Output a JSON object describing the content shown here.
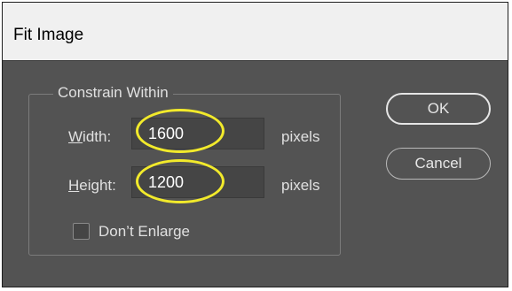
{
  "dialog": {
    "title": "Fit Image",
    "constrain": {
      "legend": "Constrain Within",
      "width": {
        "label_accel": "W",
        "label_rest": "idth:",
        "value": "1600",
        "unit": "pixels"
      },
      "height": {
        "label_accel": "H",
        "label_rest": "eight:",
        "value": "1200",
        "unit": "pixels"
      },
      "dont_enlarge": {
        "label": "Don’t Enlarge",
        "checked": false
      }
    },
    "buttons": {
      "ok": "OK",
      "cancel": "Cancel"
    }
  },
  "colors": {
    "dialog_bg": "#535353",
    "titlebar_bg": "#f0f0f0",
    "input_bg": "#454545",
    "highlight": "#f2ea2b"
  }
}
